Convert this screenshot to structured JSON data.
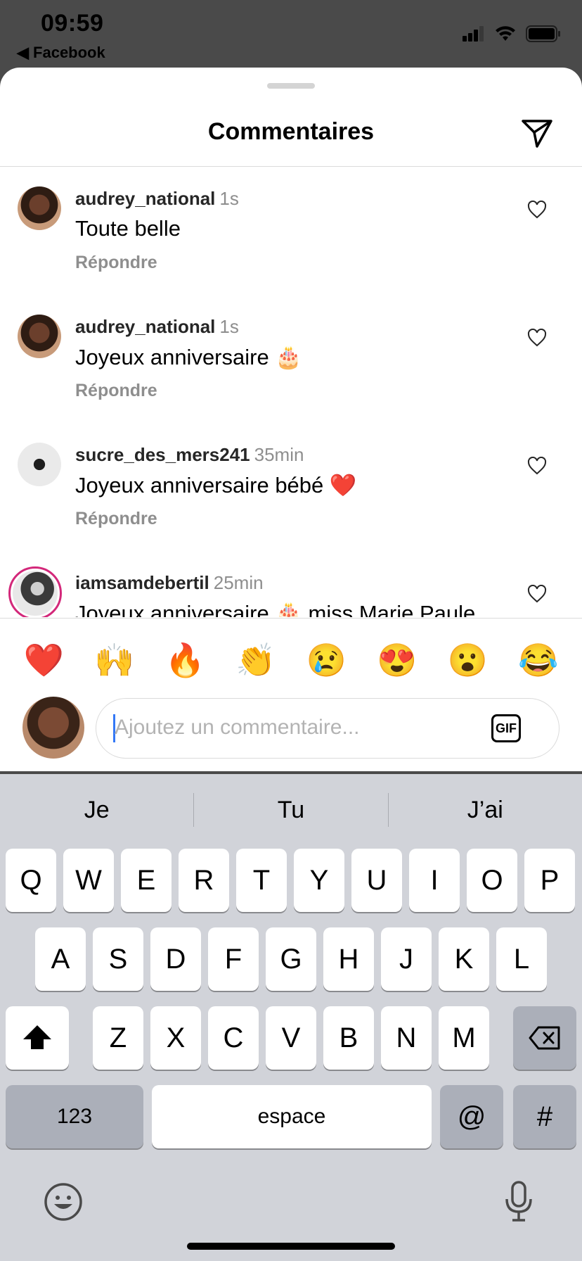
{
  "status_bar": {
    "time": "09:59",
    "back_label": "◀ Facebook"
  },
  "sheet": {
    "title": "Commentaires"
  },
  "comments": [
    {
      "username": "audrey_national",
      "time": "1s",
      "text": "Toute belle",
      "reply_label": "Répondre"
    },
    {
      "username": "audrey_national",
      "time": "1s",
      "text": "Joyeux anniversaire 🎂",
      "reply_label": "Répondre"
    },
    {
      "username": "sucre_des_mers241",
      "time": "35min",
      "text": "Joyeux anniversaire bébé ❤️",
      "reply_label": "Répondre"
    },
    {
      "username": "iamsamdebertil",
      "time": "25min",
      "text": "Joyeux anniversaire 🎂 miss Marie Paule",
      "reply_label": ""
    }
  ],
  "emoji_bar": [
    "❤️",
    "🙌",
    "🔥",
    "👏",
    "😢",
    "😍",
    "😮",
    "😂"
  ],
  "composer": {
    "placeholder": "Ajoutez un commentaire...",
    "gif_label": "GIF"
  },
  "keyboard": {
    "suggestions": [
      "Je",
      "Tu",
      "J’ai"
    ],
    "row1": [
      "Q",
      "W",
      "E",
      "R",
      "T",
      "Y",
      "U",
      "I",
      "O",
      "P"
    ],
    "row2": [
      "A",
      "S",
      "D",
      "F",
      "G",
      "H",
      "J",
      "K",
      "L"
    ],
    "row3": [
      "Z",
      "X",
      "C",
      "V",
      "B",
      "N",
      "M"
    ],
    "numbers_label": "123",
    "space_label": "espace",
    "at_label": "@",
    "hash_label": "#"
  },
  "colors": {
    "accent": "#3478f6",
    "ring": "#d3287a",
    "heart": "#e0192c"
  }
}
